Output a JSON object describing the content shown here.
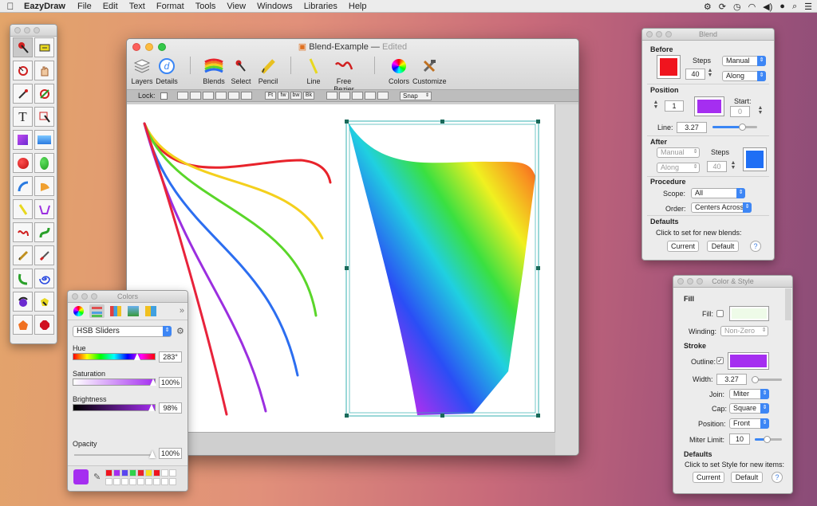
{
  "menubar": {
    "app_name": "EazyDraw",
    "items": [
      "File",
      "Edit",
      "Text",
      "Format",
      "Tools",
      "View",
      "Windows",
      "Libraries",
      "Help"
    ]
  },
  "window": {
    "title": "Blend-Example",
    "status": "Edited",
    "toolbar": {
      "layers": "Layers",
      "details": "Details",
      "blends": "Blends",
      "select": "Select",
      "pencil": "Pencil",
      "line": "Line",
      "free_bezier": "Free Bezier",
      "colors": "Colors",
      "customize": "Customize"
    },
    "lock_label": "Lock:",
    "font_buttons": [
      "Ft",
      "fw",
      "bw",
      "Bk"
    ],
    "snap": "Snap",
    "rainbow_colors": [
      "#e8232b",
      "#f27a1f",
      "#f4d01d",
      "#5ad62a",
      "#2c6ef0",
      "#9b2fe0",
      "#e8233b"
    ]
  },
  "blend": {
    "title": "Blend",
    "before": "Before",
    "steps_label": "Steps",
    "steps_value": "40",
    "manual": "Manual",
    "along": "Along",
    "position": "Position",
    "position_value": "1",
    "start_label": "Start:",
    "start_value": "0",
    "line_label": "Line:",
    "line_value": "3.27",
    "after": "After",
    "after_manual": "Manual",
    "after_along": "Along",
    "after_steps_label": "Steps",
    "after_steps_value": "40",
    "procedure": "Procedure",
    "scope_label": "Scope:",
    "scope_value": "All",
    "order_label": "Order:",
    "order_value": "Centers Across",
    "defaults": "Defaults",
    "defaults_text": "Click to set  for new blends:",
    "current": "Current",
    "default": "Default",
    "help": "?",
    "before_color": "#f0141e",
    "position_color": "#a52ef0",
    "after_color": "#1f6ff5"
  },
  "colors": {
    "title": "Colors",
    "mode": "HSB Sliders",
    "hue_label": "Hue",
    "hue_value": "283°",
    "saturation_label": "Saturation",
    "saturation_value": "100%",
    "brightness_label": "Brightness",
    "brightness_value": "98%",
    "opacity_label": "Opacity",
    "opacity_value": "100%",
    "more": "»",
    "current_color": "#a52ef0",
    "swatches": [
      "#f0141e",
      "#a52ef0",
      "#5a46f0",
      "#2fd24a",
      "#e8232b",
      "#f6e21c",
      "#f0141e",
      "#ffffff",
      "#ffffff",
      "#ffffff",
      "#ffffff",
      "#ffffff",
      "#ffffff",
      "#ffffff",
      "#ffffff",
      "#ffffff",
      "#ffffff",
      "#ffffff"
    ]
  },
  "style": {
    "title": "Color & Style",
    "fill": "Fill",
    "fill_label": "Fill:",
    "winding_label": "Winding:",
    "winding_value": "Non-Zero",
    "stroke": "Stroke",
    "outline_label": "Outline:",
    "outline_check": "✓",
    "width_label": "Width:",
    "width_value": "3.27",
    "join_label": "Join:",
    "join_value": "Miter",
    "cap_label": "Cap:",
    "cap_value": "Square",
    "position_label": "Position:",
    "position_value": "Front",
    "miter_label": "Miter Limit:",
    "miter_value": "10",
    "defaults": "Defaults",
    "defaults_text": "Click to set Style for new items:",
    "current": "Current",
    "default": "Default",
    "help": "?",
    "fill_color": "#eefbe8",
    "outline_color": "#a52ef0"
  }
}
